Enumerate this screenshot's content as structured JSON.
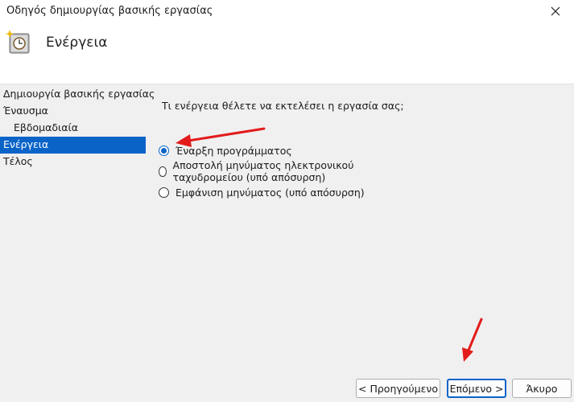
{
  "window": {
    "title": "Οδηγός δημιουργίας βασικής εργασίας"
  },
  "header": {
    "heading": "Ενέργεια"
  },
  "steps": [
    {
      "label": "Δημιουργία βασικής εργασίας",
      "active": false,
      "indent": false
    },
    {
      "label": "Έναυσμα",
      "active": false,
      "indent": false
    },
    {
      "label": "Εβδομαδιαία",
      "active": false,
      "indent": true
    },
    {
      "label": "Ενέργεια",
      "active": true,
      "indent": false
    },
    {
      "label": "Τέλος",
      "active": false,
      "indent": false
    }
  ],
  "content": {
    "question": "Τι ενέργεια θέλετε να εκτελέσει η εργασία σας;",
    "options": [
      {
        "label": "Έναρξη προγράμματος",
        "selected": true
      },
      {
        "label": "Αποστολή μηνύματος ηλεκτρονικού ταχυδρομείου (υπό απόσυρση)",
        "selected": false
      },
      {
        "label": "Εμφάνιση μηνύματος (υπό απόσυρση)",
        "selected": false
      }
    ]
  },
  "buttons": {
    "back": "< Προηγούμενο",
    "next": "Επόμενο >",
    "cancel": "Άκυρο"
  },
  "colors": {
    "accent": "#0a64c8",
    "annotation_arrow": "#e31b1b"
  }
}
